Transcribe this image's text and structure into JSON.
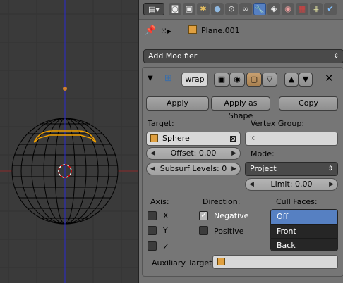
{
  "viewport": {
    "colors": {
      "background": "#3a3a3a",
      "axis_x": "#8a2a2a",
      "axis_z": "#2a2ad0",
      "wire": "#000000",
      "selected": "#f0a000"
    }
  },
  "properties": {
    "breadcrumb": {
      "object_name": "Plane.001"
    },
    "add_modifier_label": "Add Modifier",
    "modifier": {
      "name": "wrap",
      "apply_label": "Apply",
      "apply_as_shape_label": "Apply as Shape",
      "copy_label": "Copy",
      "target_label": "Target:",
      "target_value": "Sphere",
      "vertex_group_label": "Vertex Group:",
      "vertex_group_value": "",
      "offset_text": "Offset: 0.00",
      "subsurf_text": "Subsurf Levels: 0",
      "mode_label": "Mode:",
      "mode_value": "Project",
      "limit_text": "Limit: 0.00",
      "axis_label": "Axis:",
      "axis_options": [
        "X",
        "Y",
        "Z"
      ],
      "direction_label": "Direction:",
      "negative_label": "Negative",
      "positive_label": "Positive",
      "negative_checked": true,
      "positive_checked": false,
      "cull_faces_label": "Cull Faces:",
      "cull_options": [
        "Off",
        "Front",
        "Back"
      ],
      "cull_selected": "Off",
      "auxiliary_target_label": "Auxiliary Target"
    },
    "colors": {
      "panel": "#737373",
      "accent": "#5680c2",
      "dropdown_bg": "#262626"
    }
  },
  "icons": [
    "properties-editor-icon",
    "render-icon",
    "scene-icon",
    "world-icon",
    "object-icon",
    "constraints-icon",
    "modifiers-icon",
    "data-icon",
    "material-icon",
    "texture-icon",
    "particles-icon",
    "physics-icon",
    "pin-icon",
    "object-cube-icon"
  ]
}
